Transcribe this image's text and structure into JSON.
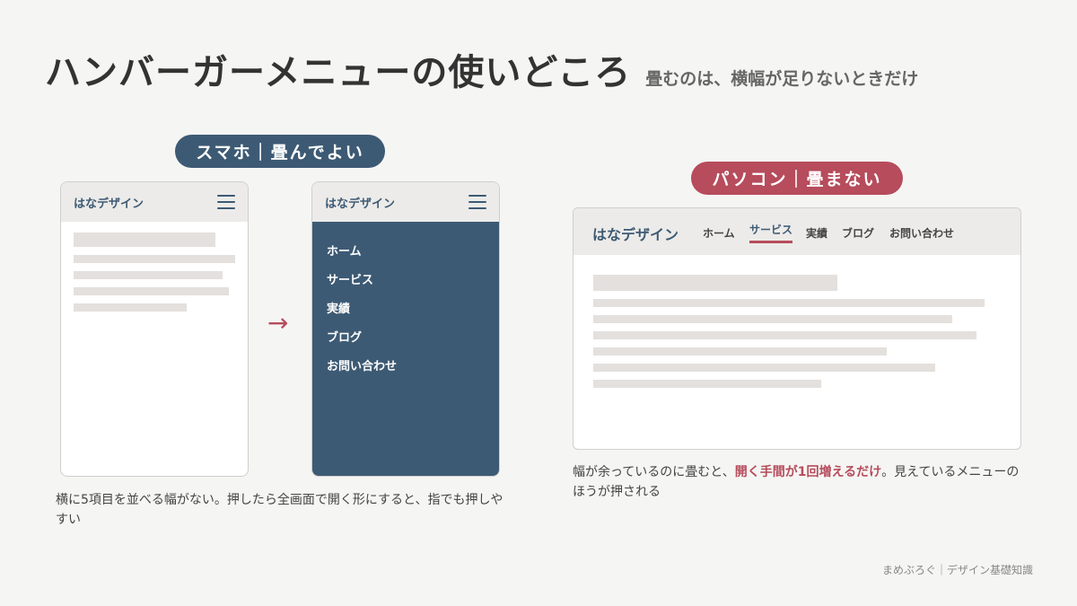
{
  "title": "ハンバーガーメニューの使いどころ",
  "subtitle": "畳むのは、横幅が足りないときだけ",
  "smartphone": {
    "label": "スマホ｜畳んでよい",
    "brand": "はなデザイン",
    "arrow": "→",
    "menu_items": [
      "ホーム",
      "サービス",
      "実績",
      "ブログ",
      "お問い合わせ"
    ],
    "caption": "横に5項目を並べる幅がない。押したら全画面で開く形にすると、指でも押しやすい"
  },
  "pc": {
    "label": "パソコン｜畳まない",
    "brand": "はなデザイン",
    "nav_items": [
      "ホーム",
      "サービス",
      "実績",
      "ブログ",
      "お問い合わせ"
    ],
    "active_nav": "サービス",
    "caption_before": "幅が余っているのに畳むと、",
    "caption_emphasis": "開く手間が1回増えるだけ",
    "caption_after": "。見えているメニューのほうが押される"
  },
  "footer": "まめぶろぐ｜デザイン基礎知識",
  "colors": {
    "navy": "#3d5a74",
    "accent": "#b64c5c",
    "background": "#f5f5f3",
    "placeholder": "#e3e0dd"
  },
  "icons": {
    "menu": "hamburger-icon",
    "arrow": "right-arrow"
  }
}
